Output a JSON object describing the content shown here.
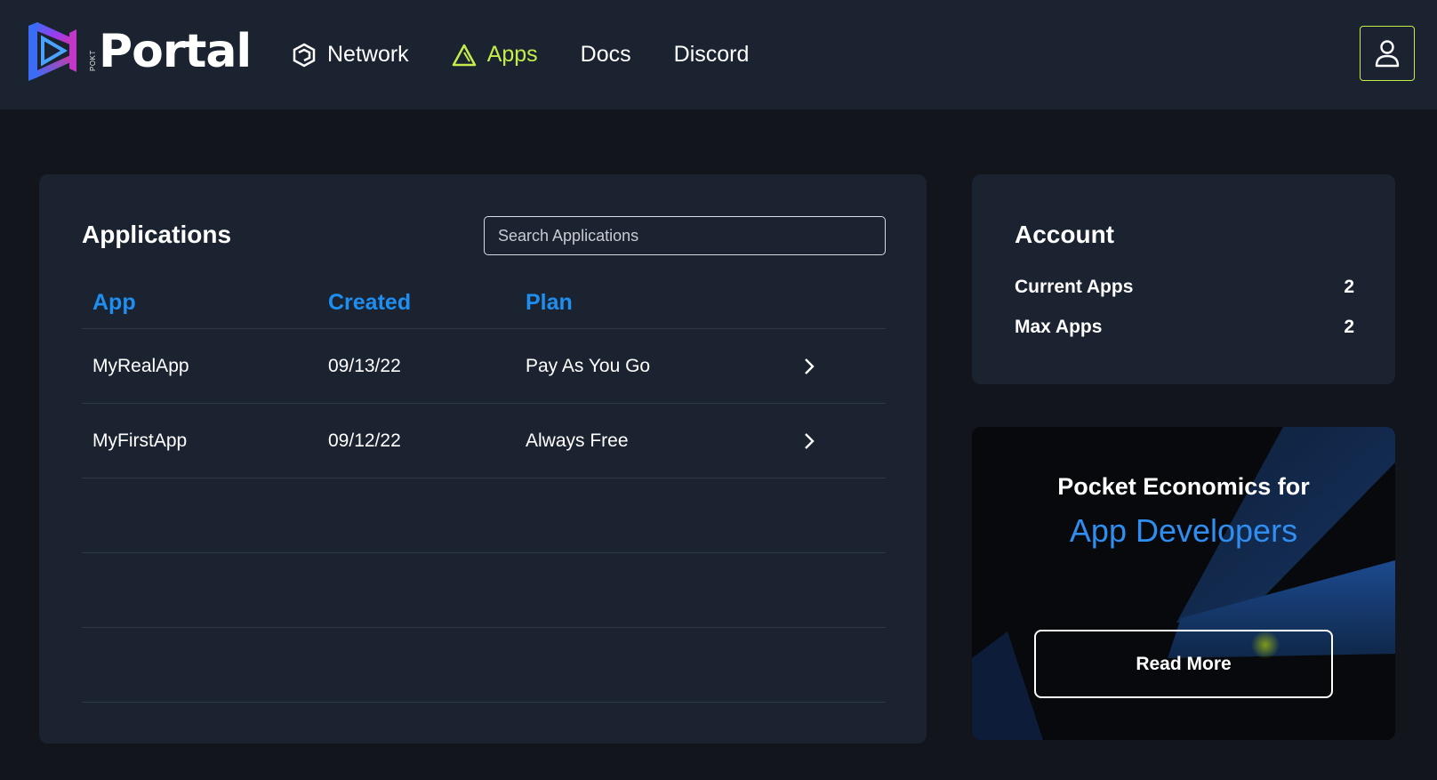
{
  "brand": {
    "pokt_label": "POKT",
    "name": "Portal"
  },
  "nav": {
    "items": [
      {
        "label": "Network",
        "icon": "network-icon",
        "active": false
      },
      {
        "label": "Apps",
        "icon": "apps-icon",
        "active": true
      },
      {
        "label": "Docs",
        "active": false
      },
      {
        "label": "Discord",
        "active": false
      }
    ],
    "accent_color": "#c5ec4b"
  },
  "applications": {
    "title": "Applications",
    "search_placeholder": "Search Applications",
    "columns": [
      "App",
      "Created",
      "Plan"
    ],
    "rows": [
      {
        "app": "MyRealApp",
        "created": "09/13/22",
        "plan": "Pay As You Go"
      },
      {
        "app": "MyFirstApp",
        "created": "09/12/22",
        "plan": "Always Free"
      }
    ]
  },
  "account": {
    "title": "Account",
    "current_apps_label": "Current Apps",
    "current_apps_value": "2",
    "max_apps_label": "Max Apps",
    "max_apps_value": "2"
  },
  "promo": {
    "line1": "Pocket Economics for",
    "line2": "App Developers",
    "button_label": "Read More"
  },
  "colors": {
    "header_bg": "#1b2331",
    "page_bg": "#12161c",
    "link_blue": "#1f8ef1"
  }
}
